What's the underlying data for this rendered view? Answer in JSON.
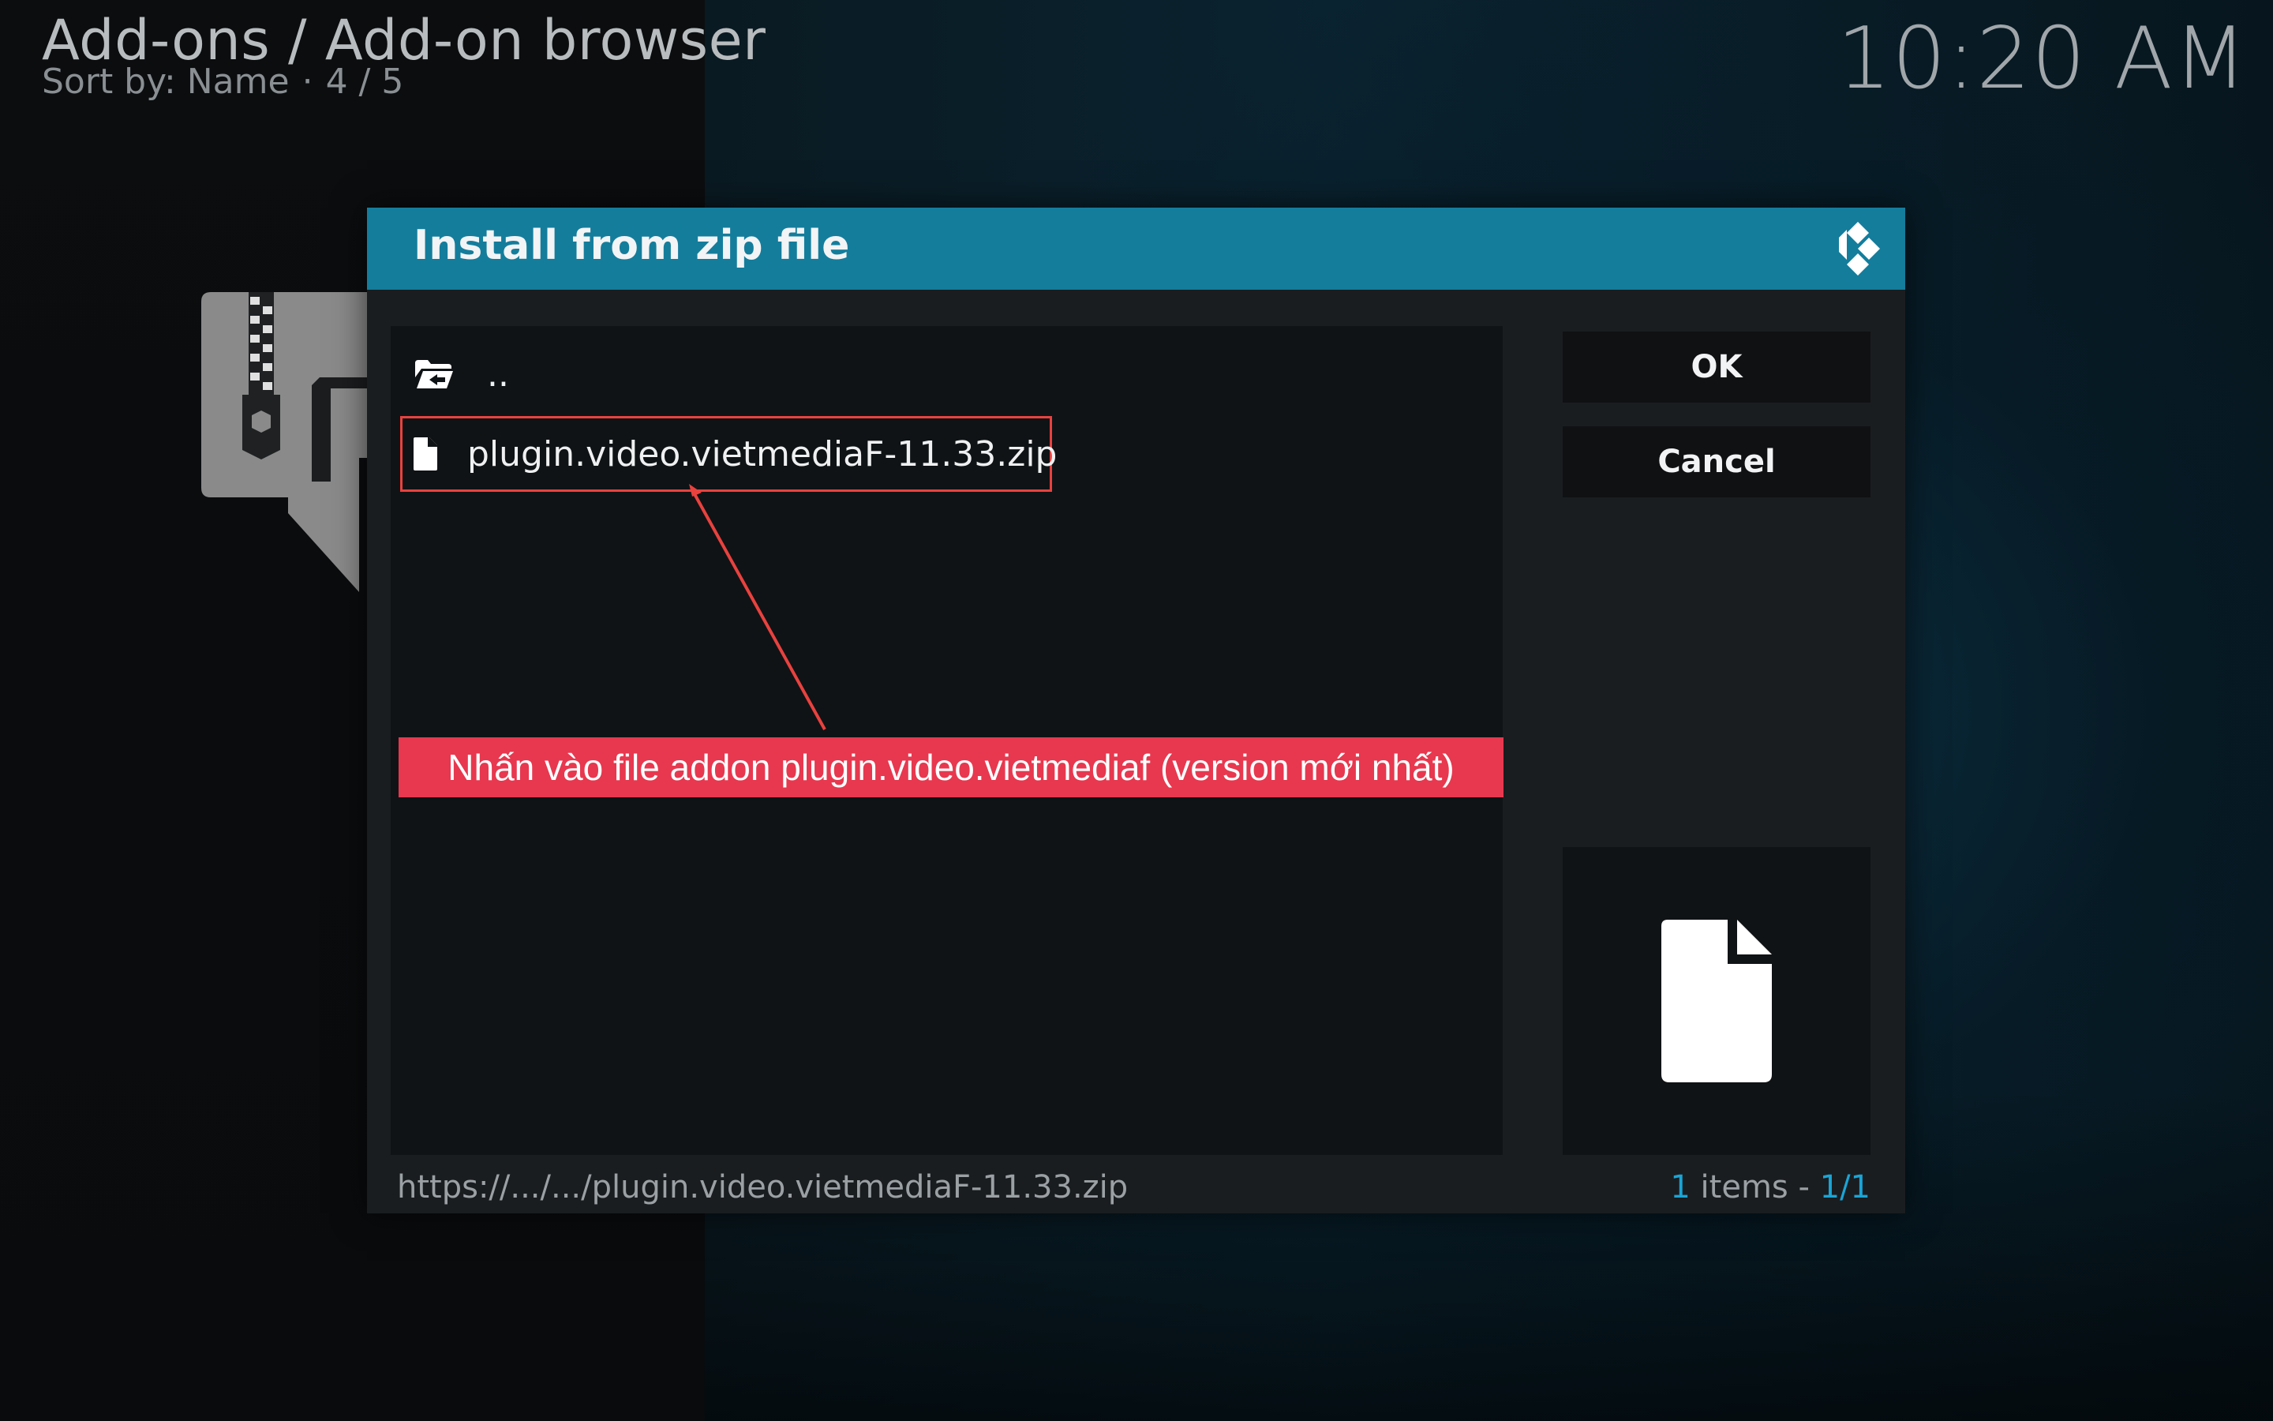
{
  "header": {
    "title": "Add-ons / Add-on browser",
    "sort_label": "Sort by: Name",
    "position": "4 / 5",
    "clock": "10:20 AM"
  },
  "dialog": {
    "title": "Install from zip file",
    "items": [
      {
        "label": "..",
        "icon": "folder-back-icon"
      },
      {
        "label": "plugin.video.vietmediaF-11.33.zip",
        "icon": "file-icon"
      }
    ],
    "buttons": {
      "ok": "OK",
      "cancel": "Cancel"
    },
    "path": "https://.../.../plugin.video.vietmediaF-11.33.zip",
    "count_num": "1",
    "count_label": "items -",
    "count_page": "1/1"
  },
  "annotation": {
    "text": "Nhấn vào file addon plugin.video.vietmediaf (version mới nhất)",
    "color": "#e7384f",
    "outline_color": "#e8423f"
  },
  "colors": {
    "header_bar": "#147d9c",
    "accent": "#1aa5d6"
  }
}
